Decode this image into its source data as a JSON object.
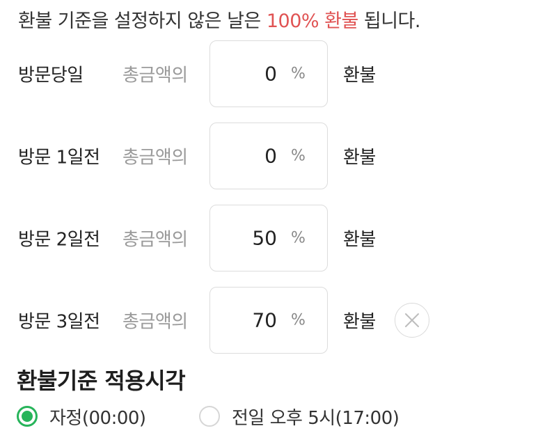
{
  "notice": {
    "prefix": "환불 기준을 설정하지 않은 날은 ",
    "highlight": "100% 환불",
    "suffix": " 됩니다.",
    "highlight_color": "#e05353"
  },
  "refund_rules": [
    {
      "label": "방문당일",
      "sub_label": "총금액의",
      "value": "0",
      "unit": "%",
      "suffix": "환불"
    },
    {
      "label": "방문 1일전",
      "sub_label": "총금액의",
      "value": "0",
      "unit": "%",
      "suffix": "환불"
    },
    {
      "label": "방문 2일전",
      "sub_label": "총금액의",
      "value": "50",
      "unit": "%",
      "suffix": "환불"
    },
    {
      "label": "방문 3일전",
      "sub_label": "총금액의",
      "value": "70",
      "unit": "%",
      "suffix": "환불",
      "remove_icon": "close-icon"
    }
  ],
  "apply_time": {
    "title": "환불기준 적용시각",
    "options": [
      {
        "label": "자정(00:00)",
        "selected": true
      },
      {
        "label": "전일 오후 5시(17:00)",
        "selected": false
      }
    ],
    "accent_color": "#27b45a"
  }
}
